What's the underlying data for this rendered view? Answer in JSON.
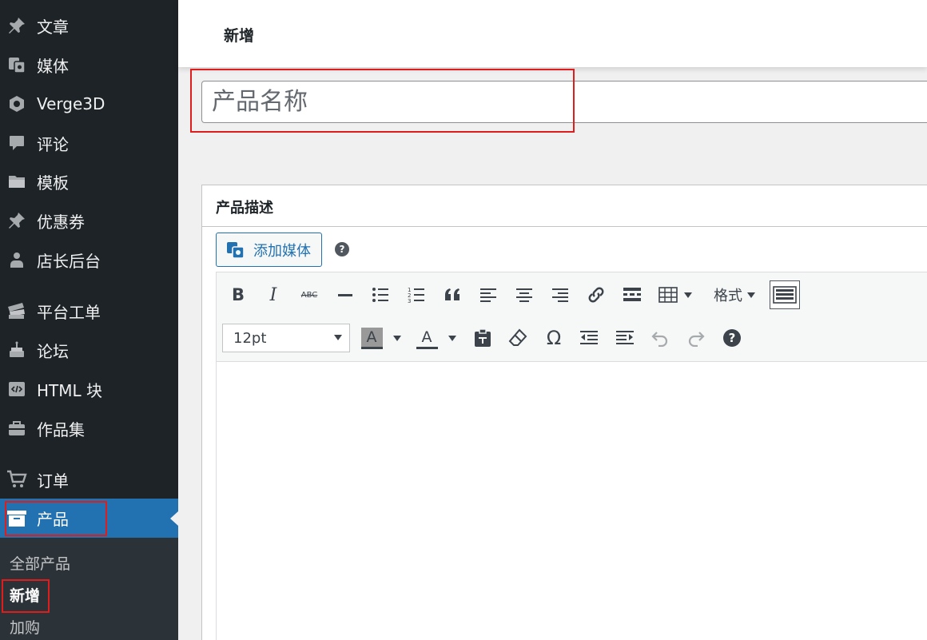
{
  "sidebar": {
    "items": [
      {
        "label": "文章",
        "icon": "pin-icon"
      },
      {
        "label": "媒体",
        "icon": "media-icon"
      },
      {
        "label": "Verge3D",
        "icon": "verge3d-icon"
      },
      {
        "label": "评论",
        "icon": "comment-icon"
      },
      {
        "label": "模板",
        "icon": "folder-icon"
      },
      {
        "label": "优惠券",
        "icon": "pin-icon"
      },
      {
        "label": "店长后台",
        "icon": "user-icon"
      },
      {
        "label": "平台工单",
        "icon": "tickets-icon"
      },
      {
        "label": "论坛",
        "icon": "cake-icon"
      },
      {
        "label": "HTML 块",
        "icon": "code-icon"
      },
      {
        "label": "作品集",
        "icon": "portfolio-icon"
      },
      {
        "label": "订单",
        "icon": "cart-icon"
      },
      {
        "label": "产品",
        "icon": "archive-icon"
      }
    ],
    "submenu": [
      "全部产品",
      "新增",
      "加购"
    ]
  },
  "header": {
    "title": "新增"
  },
  "title_input": {
    "placeholder": "产品名称"
  },
  "description": {
    "title": "产品描述",
    "add_media_label": "添加媒体",
    "font_size": "12pt",
    "format_label": "格式"
  },
  "colors": {
    "sidebar_bg": "#1d2327",
    "accent": "#2271b1",
    "highlight": "#e01d1d"
  }
}
